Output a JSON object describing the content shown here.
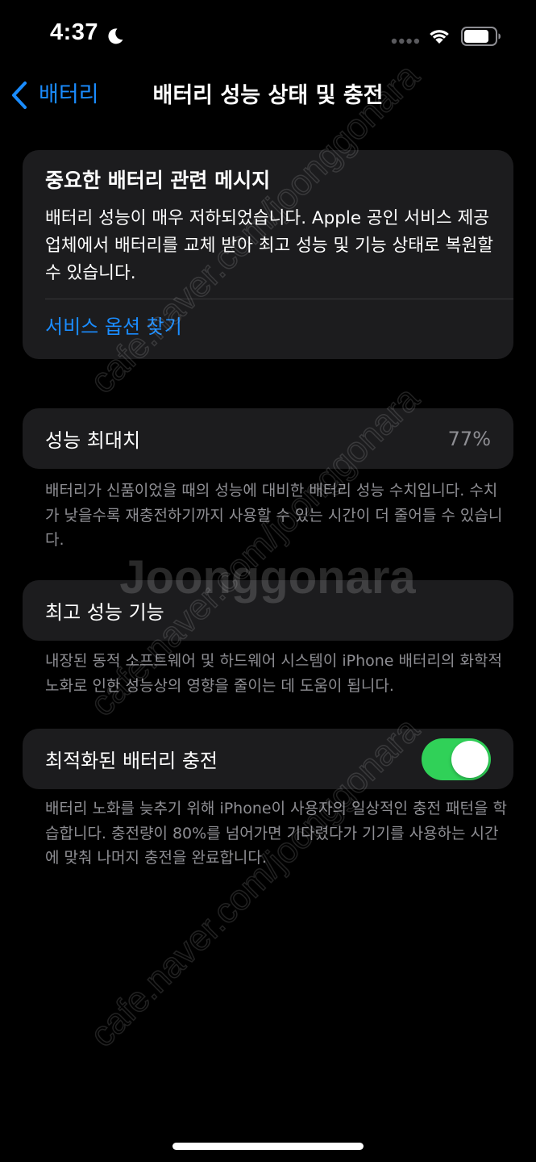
{
  "status_bar": {
    "time": "4:37",
    "icons": [
      "moon-icon",
      "signal-icon",
      "wifi-icon",
      "battery-icon"
    ]
  },
  "nav": {
    "back_label": "배터리",
    "title": "배터리 성능 상태 및 충전"
  },
  "message_card": {
    "title": "중요한 배터리 관련 메시지",
    "body": "배터리 성능이 매우 저하되었습니다. Apple 공인 서비스 제공업체에서 배터리를 교체 받아 최고 성능 및 기능 상태로 복원할 수 있습니다.",
    "link": "서비스 옵션 찾기"
  },
  "peak_capacity": {
    "label": "성능 최대치",
    "value": "77%",
    "footer": "배터리가 신품이었을 때의 성능에 대비한 배터리 성능 수치입니다. 수치가 낮을수록 재충전하기까지 사용할 수 있는 시간이 더 줄어들 수 있습니다."
  },
  "peak_performance": {
    "label": "최고 성능 기능",
    "footer": "내장된 동적 소프트웨어 및 하드웨어 시스템이 iPhone 배터리의 화학적 노화로 인한 성능상의 영향을 줄이는 데 도움이 됩니다."
  },
  "optimized_charging": {
    "label": "최적화된 배터리 충전",
    "enabled": true,
    "footer": "배터리 노화를 늦추기 위해 iPhone이 사용자의 일상적인 충전 패턴을 학습합니다. 충전량이 80%를 넘어가면 기다렸다가 기기를 사용하는 시간에 맞춰 나머지 충전을 완료합니다."
  },
  "colors": {
    "accent": "#1a8cff",
    "toggle_on": "#30d158",
    "card_bg": "#1c1c1e",
    "secondary_text": "#8e8e93"
  },
  "watermark": {
    "brand": "Joonggonara",
    "url": "cafe.naver.com/joonggonara"
  }
}
